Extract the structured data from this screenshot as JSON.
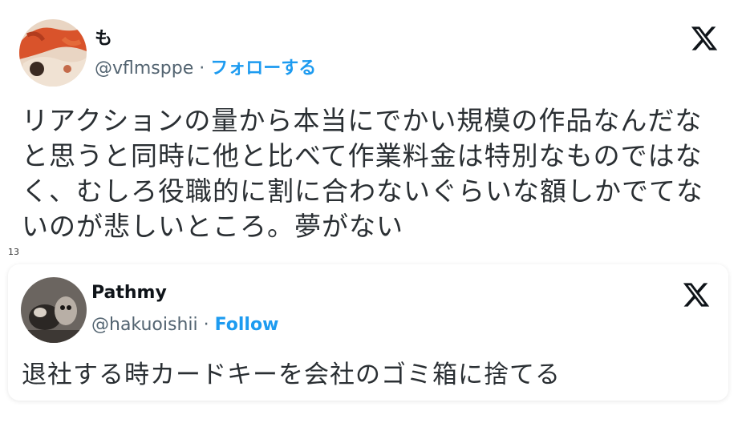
{
  "tweets": [
    {
      "display_name": "も",
      "handle": "@vflmsppe",
      "separator": "·",
      "follow_label": "フォローする",
      "lines": [
        "リアクションの量から本当にでかい規模の作品なんだな",
        "と思うと同時に他と比べて作業料金は特別なものではな",
        "く、むしろ役職的に割に合わないぐらいな額しかでてな",
        "いのが悲しいところ。夢がない"
      ]
    },
    {
      "display_name": "Pathmy",
      "handle": "@hakuoishii",
      "separator": "·",
      "follow_label": "Follow",
      "lines": [
        "退社する時カードキーを会社のゴミ箱に捨てる"
      ]
    }
  ],
  "between_label": "13",
  "icons": {
    "platform_logo": "x-logo-icon",
    "avatar_1": "avatar-image",
    "avatar_2": "avatar-image"
  },
  "colors": {
    "follow": "#1d9bf0",
    "handle": "#536471",
    "text": "#0f1419"
  }
}
